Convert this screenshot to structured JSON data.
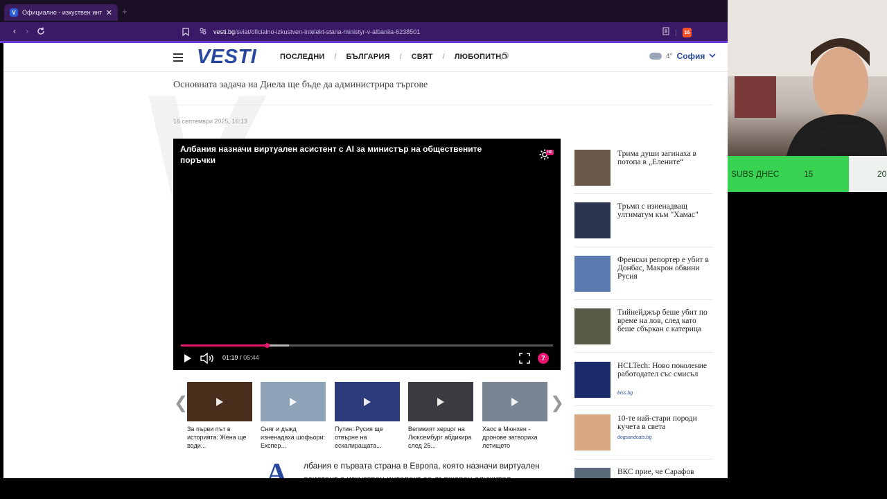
{
  "browser": {
    "tab_title": "Официално - изкуствен интел...",
    "tab_favicon": "V",
    "new_tab": "+",
    "url_domain": "vesti.bg",
    "url_path": "/sviat/oficialno-izkustven-intelekt-stana-ministyr-v-albaniia-6238501",
    "brave_badge": "16"
  },
  "site": {
    "logo": "VESTI",
    "nav": [
      "ПОСЛЕДНИ",
      "БЪЛГАРИЯ",
      "СВЯТ",
      "ЛЮБОПИТНО"
    ],
    "nav_sep": "/",
    "weather_temp": "4°",
    "weather_city": "София"
  },
  "article": {
    "subtitle": "Основната задача на Диела ще бъде да администрира търгове",
    "date": "16 септември 2025, 16:13",
    "dropcap": "А",
    "body": "лбания е първата страна в Европа, която назначи виртуален асистент с изкуствен интелект за държавен служител"
  },
  "player": {
    "title": "Албания назначи виртуален асистент с AI за министър на обществените поръчки",
    "hd_badge": "HD",
    "current_time": "01:19",
    "time_sep": "/",
    "duration": "05:44",
    "played_fraction": 0.23,
    "buffered_fraction": 0.29,
    "channel_logo": "7"
  },
  "carousel": {
    "prev": "❮",
    "next": "❯",
    "items": [
      {
        "caption": "За първи път в историята: Жена ще води...",
        "color": "#4a2e1c"
      },
      {
        "caption": "Сняг и дъжд изненадаха шофьори: Експер...",
        "color": "#8fa3b8"
      },
      {
        "caption": "Путин: Русия ще отвърне на ескалиращата...",
        "color": "#2b3a7a"
      },
      {
        "caption": "Великият херцог на Люксембург абдикира след 25...",
        "color": "#3a3a40"
      },
      {
        "caption": "Хаос в Мюнхен - дронове затвориха летището",
        "color": "#7a8594"
      }
    ]
  },
  "sidebar": [
    {
      "text": "Трима души загинаха в потопа в „Елените“",
      "source": "",
      "color": "#6b5a4a"
    },
    {
      "text": "Тръмп с изненадващ ултиматум към \"Хамас\"",
      "source": "",
      "color": "#2a3550"
    },
    {
      "text": "Френски репортер е убит в Донбас, Макрон обвини Русия",
      "source": "",
      "color": "#5b7bb0"
    },
    {
      "text": "Тийнейджър беше убит по време на лов, след като беше сбъркан с катерица",
      "source": "",
      "color": "#5a5a48"
    },
    {
      "text": "HCLTech: Ново поколение работодател със смисъл",
      "source": "biss.bg",
      "color": "#1a2a6a"
    },
    {
      "text": "10-те най-стари породи кучета в света",
      "source": "dogsandcats.bg",
      "color": "#d8a880"
    },
    {
      "text": "ВКС прие, че Сарафов",
      "source": "",
      "color": "#5a6a7a"
    }
  ],
  "overlay": {
    "subs_label": "SUBS ДНЕС",
    "subs_count": "15",
    "subs_goal": "20"
  }
}
